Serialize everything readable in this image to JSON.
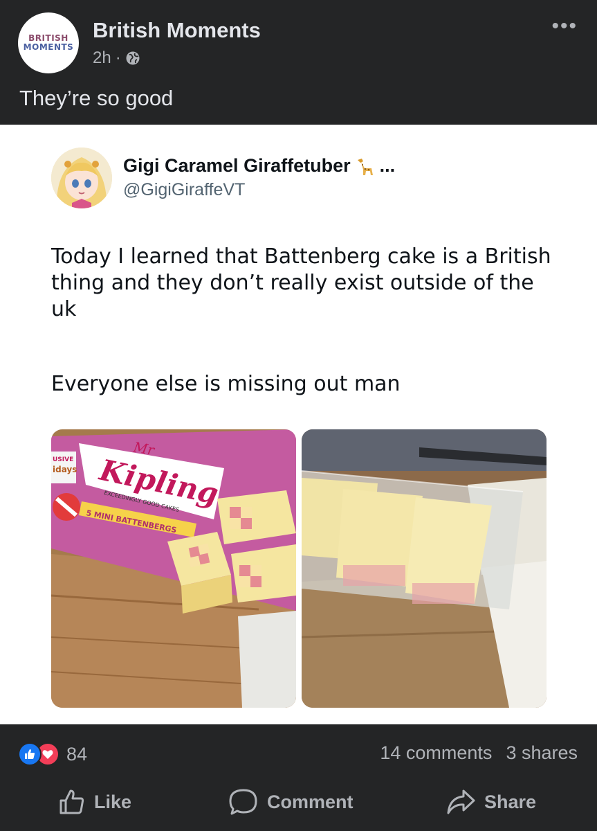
{
  "post": {
    "avatar_line1": "BRITISH",
    "avatar_line2": "MOMENTS",
    "page_name": "British Moments",
    "time": "2h",
    "separator": "·",
    "more_label": "•••",
    "caption": "They’re so good"
  },
  "tweet": {
    "display_name": "Gigi Caramel Giraffetuber",
    "name_suffix": "...",
    "handle": "@GigiGiraffeVT",
    "text1": "Today I learned that Battenberg cake is a British thing and they don’t really exist outside of the uk",
    "text2": "Everyone else is missing out man",
    "photo1": {
      "brand_top": "Mr",
      "brand": "Kipling",
      "tagline": "EXCEEDINGLY GOOD CAKES",
      "product": "5 MINI BATTENBERGS",
      "side_text1": "USIVE",
      "side_text2": "idays"
    }
  },
  "footer": {
    "reaction_count": "84",
    "comments": "14 comments",
    "shares": "3 shares",
    "like_label": "Like",
    "comment_label": "Comment",
    "share_label": "Share"
  },
  "colors": {
    "background": "#242526",
    "text": "#e4e6eb",
    "secondary": "#b0b3b8",
    "like_blue": "#1877f2",
    "love_red": "#f33e58"
  }
}
